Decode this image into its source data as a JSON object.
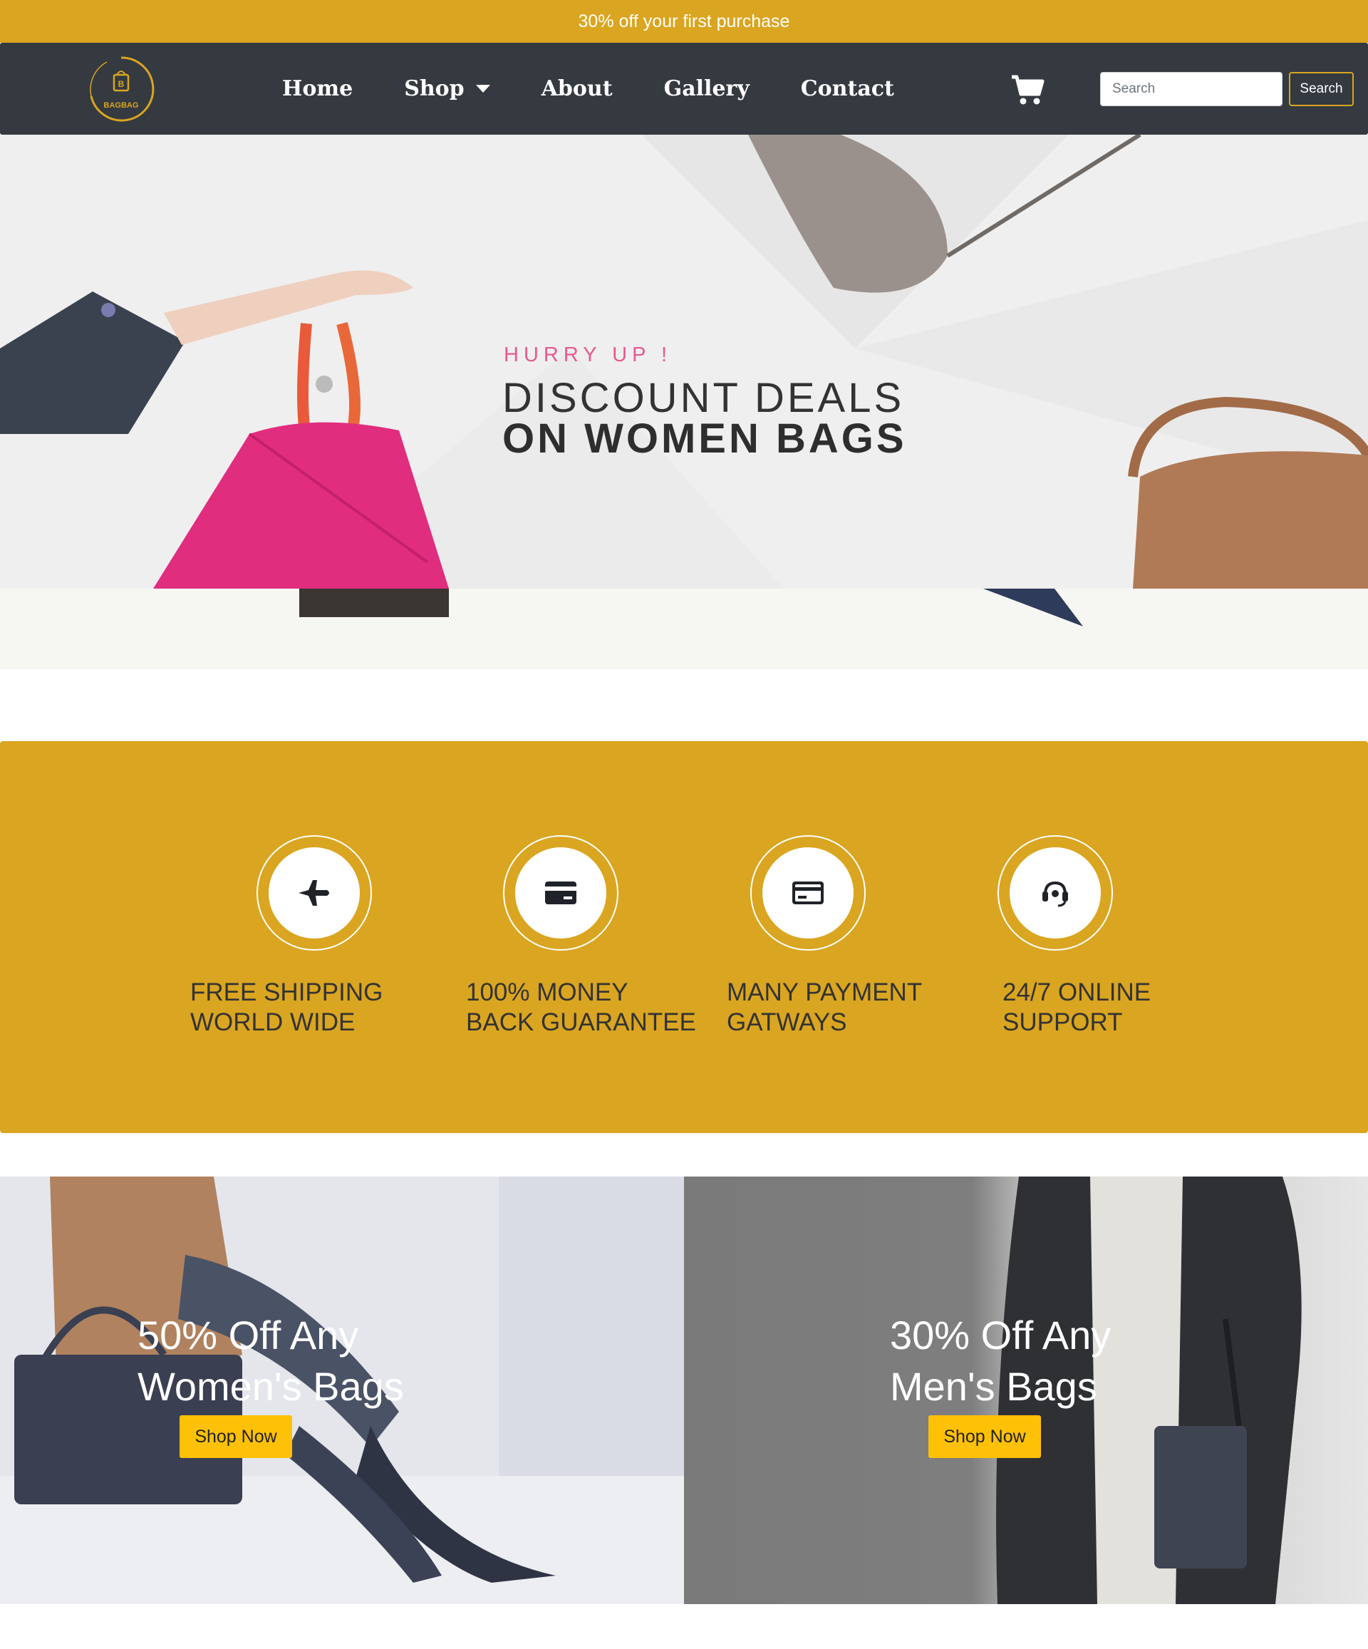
{
  "promo_bar": {
    "text": "30% off your first purchase"
  },
  "navbar": {
    "logo_text": "BAGBAG",
    "links": [
      {
        "label": "Home"
      },
      {
        "label": "Shop"
      },
      {
        "label": "About"
      },
      {
        "label": "Gallery"
      },
      {
        "label": "Contact"
      }
    ],
    "search_placeholder": "Search",
    "search_button": "Search"
  },
  "hero": {
    "kicker": "HURRY UP !",
    "line1": "DISCOUNT DEALS",
    "line2": "ON WOMEN BAGS"
  },
  "features": [
    {
      "icon": "airplane-icon",
      "line1": "FREE SHIPPING",
      "line2": "WORLD WIDE"
    },
    {
      "icon": "credit-card-icon",
      "line1": "100% MONEY",
      "line2": "BACK GUARANTEE"
    },
    {
      "icon": "payment-card-icon",
      "line1": "MANY PAYMENT",
      "line2": "GATWAYS"
    },
    {
      "icon": "headset-icon",
      "line1": "24/7 ONLINE",
      "line2": "SUPPORT"
    }
  ],
  "promos": [
    {
      "line1": "50% Off Any",
      "line2": "Women's Bags",
      "button": "Shop Now"
    },
    {
      "line1": "30% Off Any",
      "line2": "Men's Bags",
      "button": "Shop Now"
    }
  ],
  "colors": {
    "accent": "#DAA520",
    "navbar": "#343a40",
    "button": "#FFC107"
  }
}
